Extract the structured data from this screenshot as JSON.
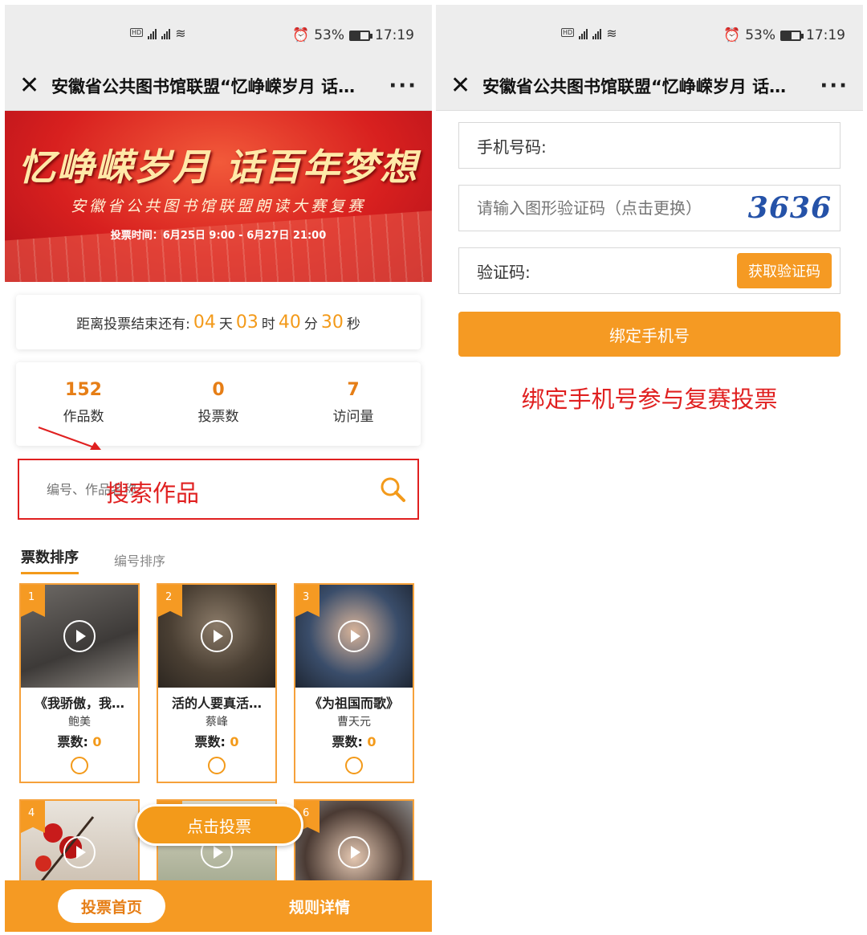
{
  "status_bar": {
    "battery_pct": "53%",
    "battery_level": 0.53,
    "time": "17:19",
    "network": "4G"
  },
  "webview": {
    "title": "安徽省公共图书馆联盟“忆峥嵘岁月 话…"
  },
  "banner": {
    "title": "忆峥嵘岁月 话百年梦想",
    "subtitle": "安徽省公共图书馆联盟朗读大赛复赛",
    "time": "投票时间：6月25日 9:00 - 6月27日 21:00"
  },
  "countdown": {
    "label": "距离投票结束还有:",
    "days": "04",
    "days_unit": "天",
    "hours": "03",
    "hours_unit": "时",
    "minutes": "40",
    "minutes_unit": "分",
    "seconds": "30",
    "seconds_unit": "秒"
  },
  "stats": [
    {
      "value": "152",
      "label": "作品数"
    },
    {
      "value": "0",
      "label": "投票数"
    },
    {
      "value": "7",
      "label": "访问量"
    }
  ],
  "search": {
    "placeholder": "编号、作品名称、",
    "annotation": "搜索作品"
  },
  "sort_tabs": [
    {
      "label": "票数排序"
    },
    {
      "label": "编号排序"
    }
  ],
  "entries": [
    {
      "rank": "1",
      "title": "《我骄傲，我…",
      "author": "鲍美",
      "votes_label": "票数:",
      "votes": "0"
    },
    {
      "rank": "2",
      "title": "活的人要真活…",
      "author": "蔡峰",
      "votes_label": "票数:",
      "votes": "0"
    },
    {
      "rank": "3",
      "title": "《为祖国而歌》",
      "author": "曹天元",
      "votes_label": "票数:",
      "votes": "0"
    },
    {
      "rank": "4"
    },
    {
      "rank": "5"
    },
    {
      "rank": "6"
    }
  ],
  "vote_button": "点击投票",
  "bottom_tabs": {
    "home": "投票首页",
    "rules": "规则详情"
  },
  "bind_form": {
    "phone_label": "手机号码:",
    "captcha_placeholder": "请输入图形验证码（点击更换）",
    "captcha_text": "3636",
    "sms_label": "验证码:",
    "sms_button": "获取验证码",
    "submit": "绑定手机号",
    "note": "绑定手机号参与复赛投票"
  },
  "colors": {
    "accent": "#f59a23",
    "annotation": "#e02020",
    "banner": "#d8201f"
  }
}
